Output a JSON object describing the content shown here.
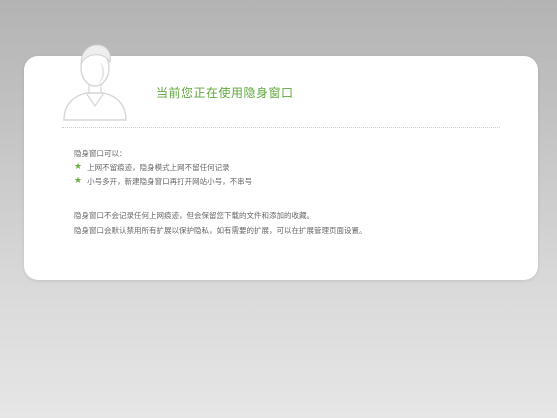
{
  "title": "当前您正在使用隐身窗口",
  "intro": "隐身窗口可以：",
  "features": [
    "上网不留痕迹，隐身模式上网不留任何记录",
    "小号多开，新建隐身窗口再打开网站小号，不串号"
  ],
  "notes": [
    "隐身窗口不会记录任何上网痕迹，但会保留您下载的文件和添加的收藏。",
    "隐身窗口会默认禁用所有扩展以保护隐私，如有需要的扩展，可以在扩展管理页面设置。"
  ],
  "colors": {
    "title": "#5fa73c",
    "star": "#6cae3f",
    "text": "#666666"
  },
  "icons": {
    "avatar": "incognito-person-icon",
    "bullet": "star-icon"
  }
}
